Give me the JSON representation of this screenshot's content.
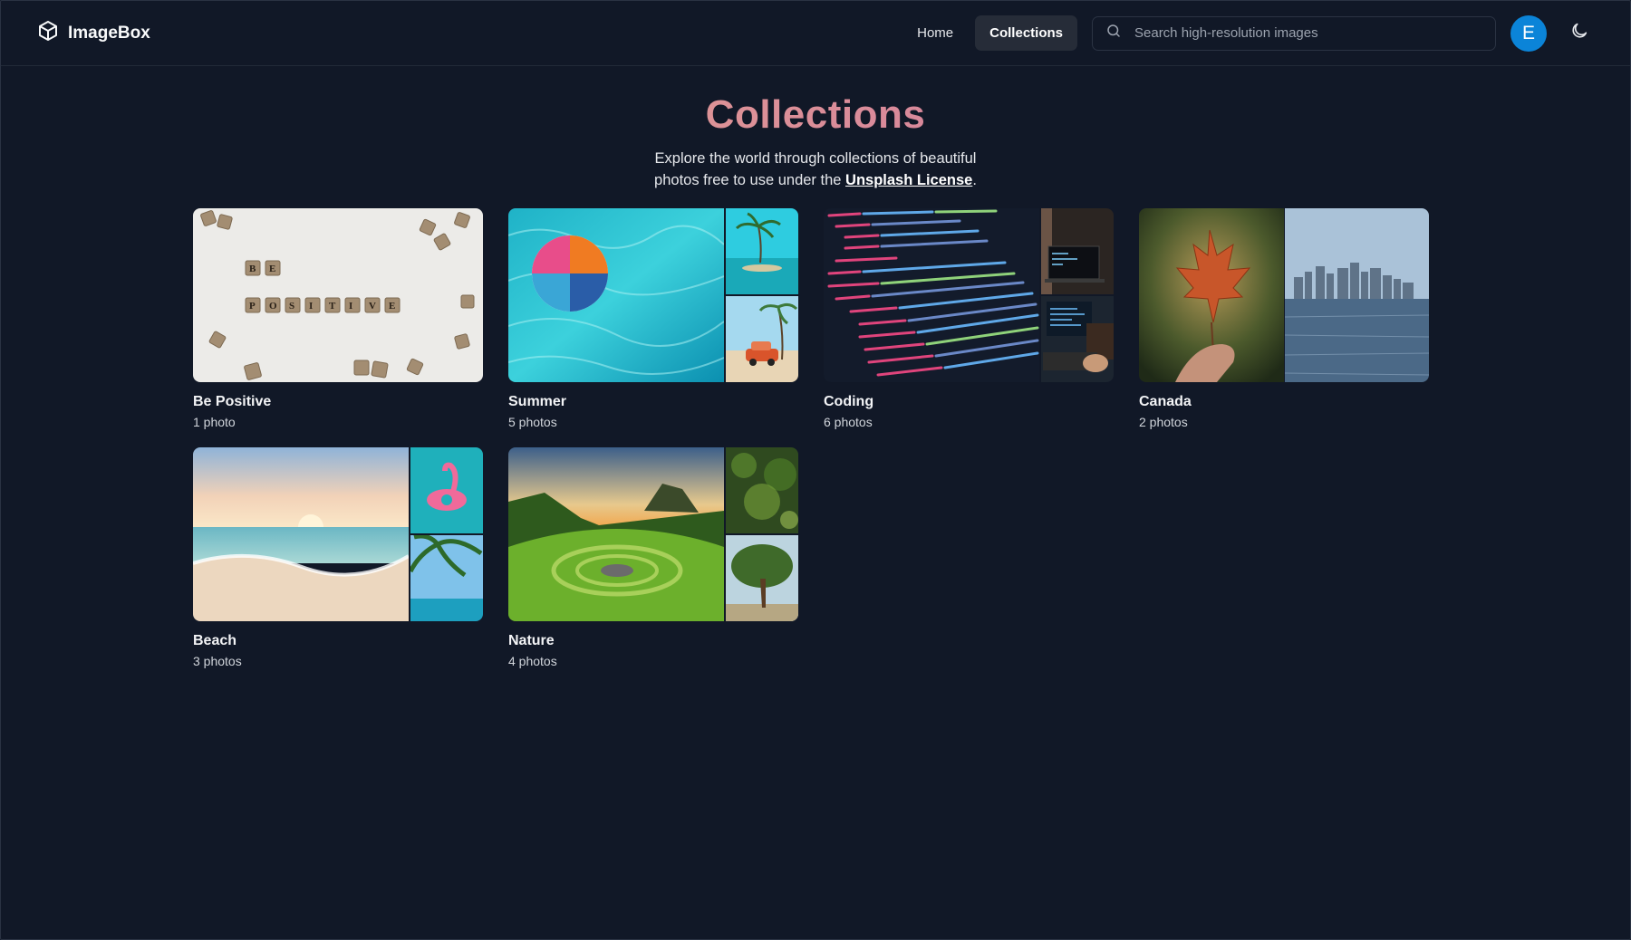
{
  "app": {
    "name": "ImageBox",
    "logo_icon": "cube-icon"
  },
  "nav": {
    "home_label": "Home",
    "collections_label": "Collections",
    "active": "Collections"
  },
  "search": {
    "placeholder": "Search high-resolution images",
    "value": ""
  },
  "user": {
    "initial": "E",
    "avatar_color": "#0b84d8"
  },
  "page": {
    "title": "Collections",
    "subtitle_line1": "Explore the world through collections of beautiful",
    "subtitle_line2_prefix": "photos free to use under the ",
    "license_link": "Unsplash License",
    "subtitle_line2_suffix": "."
  },
  "collections": [
    {
      "title": "Be Positive",
      "count": "1 photo",
      "layout": "single",
      "images": [
        "scrabble-tiles-photo"
      ]
    },
    {
      "title": "Summer",
      "count": "5 photos",
      "layout": "three",
      "images": [
        "beach-ball-pool-photo",
        "palm-island-photo",
        "vintage-car-beach-photo"
      ]
    },
    {
      "title": "Coding",
      "count": "6 photos",
      "layout": "three",
      "images": [
        "code-editor-photo",
        "laptop-desk-photo",
        "developer-monitor-photo"
      ]
    },
    {
      "title": "Canada",
      "count": "2 photos",
      "layout": "two",
      "images": [
        "maple-leaf-photo",
        "toronto-skyline-photo"
      ]
    },
    {
      "title": "Beach",
      "count": "3 photos",
      "layout": "three",
      "images": [
        "sunset-beach-photo",
        "flamingo-float-photo",
        "palm-ocean-photo"
      ]
    },
    {
      "title": "Nature",
      "count": "4 photos",
      "layout": "three",
      "images": [
        "green-valley-photo",
        "forest-bokeh-photo",
        "lone-tree-photo"
      ]
    }
  ]
}
